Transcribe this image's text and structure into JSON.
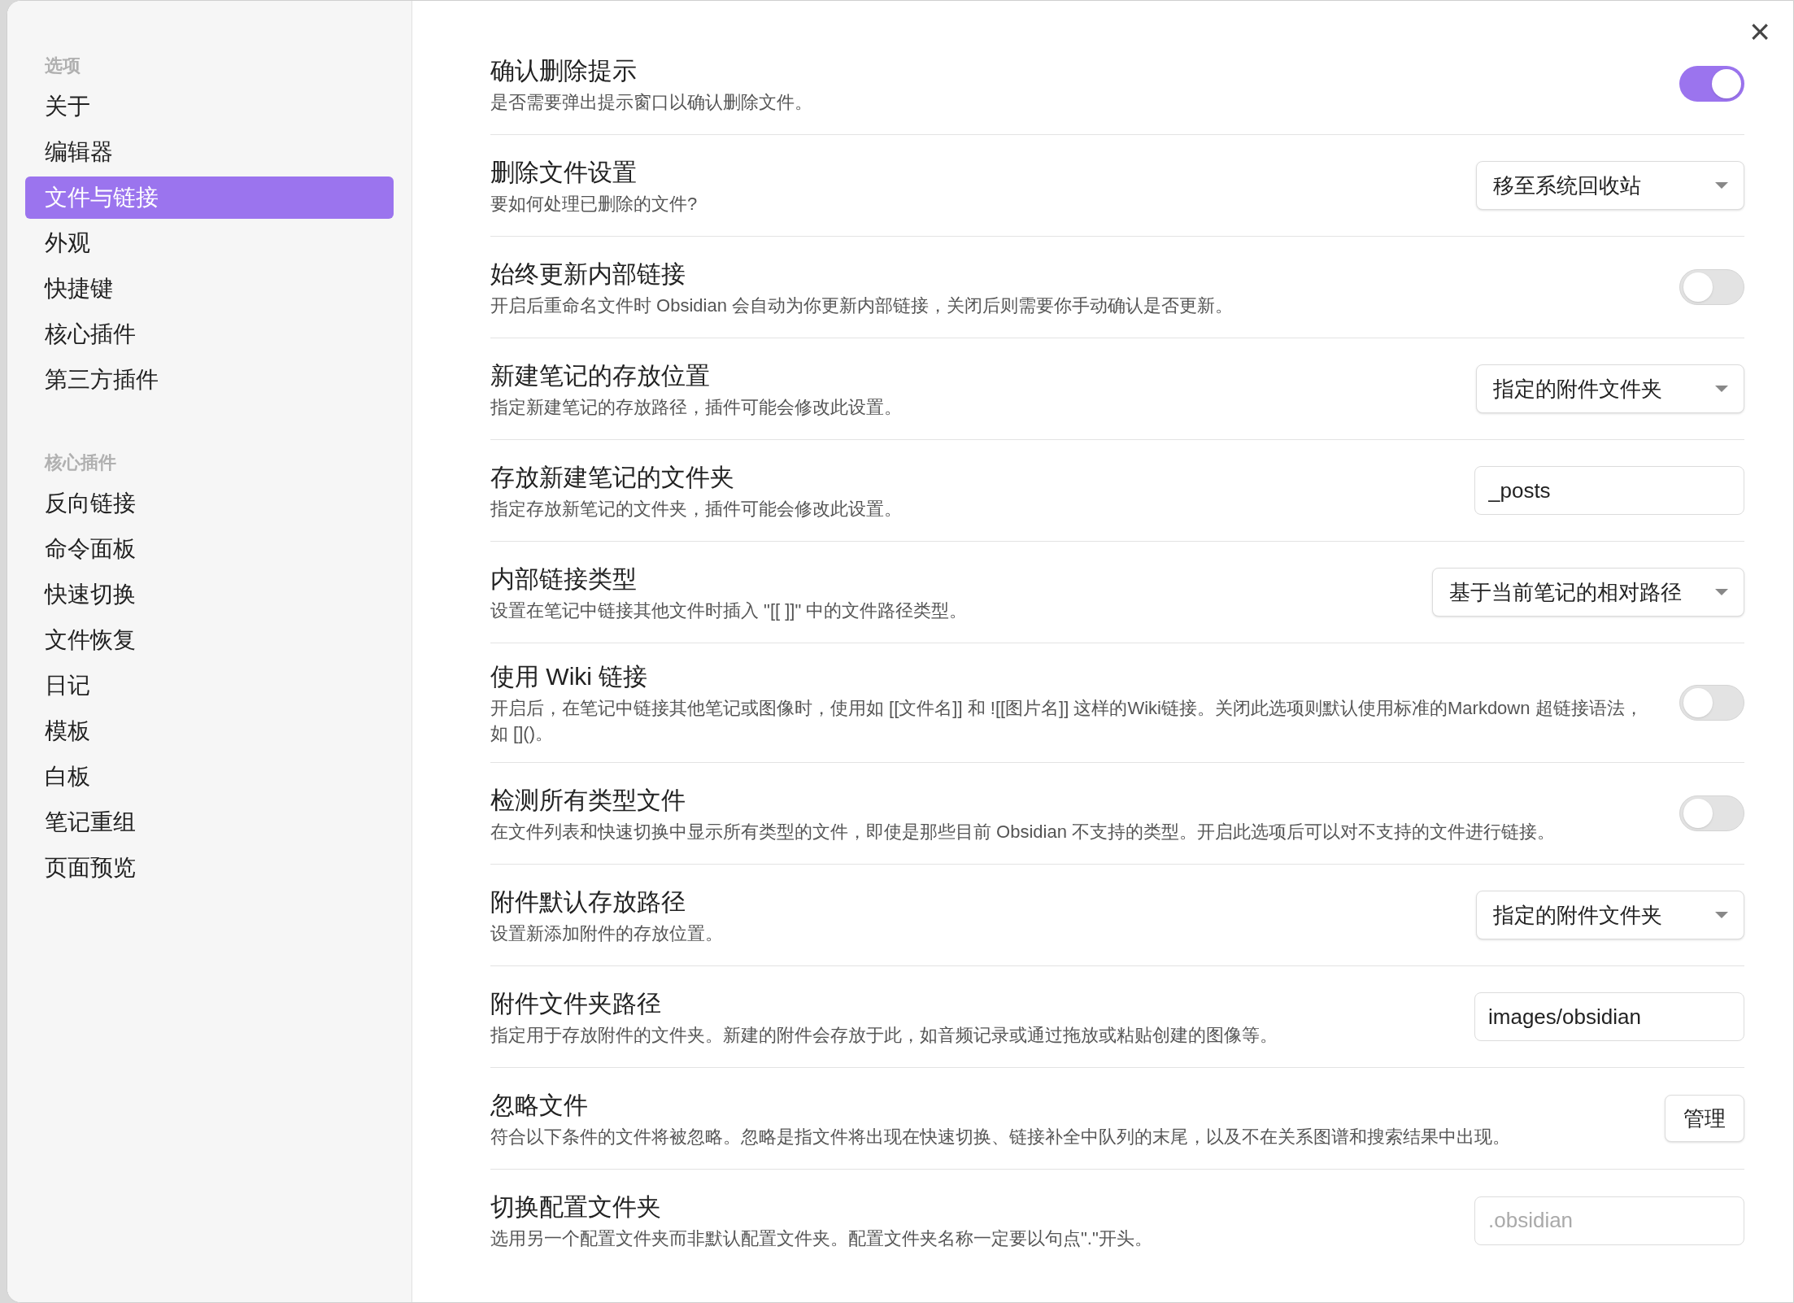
{
  "sidebar": [
    {
      "heading": "选项",
      "items": [
        {
          "label": "关于",
          "selected": false
        },
        {
          "label": "编辑器",
          "selected": false
        },
        {
          "label": "文件与链接",
          "selected": true
        },
        {
          "label": "外观",
          "selected": false
        },
        {
          "label": "快捷键",
          "selected": false
        },
        {
          "label": "核心插件",
          "selected": false
        },
        {
          "label": "第三方插件",
          "selected": false
        }
      ]
    },
    {
      "heading": "核心插件",
      "items": [
        {
          "label": "反向链接",
          "selected": false
        },
        {
          "label": "命令面板",
          "selected": false
        },
        {
          "label": "快速切换",
          "selected": false
        },
        {
          "label": "文件恢复",
          "selected": false
        },
        {
          "label": "日记",
          "selected": false
        },
        {
          "label": "模板",
          "selected": false
        },
        {
          "label": "白板",
          "selected": false
        },
        {
          "label": "笔记重组",
          "selected": false
        },
        {
          "label": "页面预览",
          "selected": false
        }
      ]
    }
  ],
  "close_button": "×",
  "settings": [
    {
      "title": "确认删除提示",
      "description": "是否需要弹出提示窗口以确认删除文件。",
      "control": {
        "kind": "toggle",
        "on": true
      }
    },
    {
      "title": "删除文件设置",
      "description": "要如何处理已删除的文件?",
      "control": {
        "kind": "dropdown",
        "value": "移至系统回收站"
      }
    },
    {
      "title": "始终更新内部链接",
      "description": "开启后重命名文件时 Obsidian 会自动为你更新内部链接，关闭后则需要你手动确认是否更新。",
      "control": {
        "kind": "toggle",
        "on": false
      }
    },
    {
      "title": "新建笔记的存放位置",
      "description": "指定新建笔记的存放路径，插件可能会修改此设置。",
      "control": {
        "kind": "dropdown",
        "value": "指定的附件文件夹"
      }
    },
    {
      "title": "存放新建笔记的文件夹",
      "description": "指定存放新笔记的文件夹，插件可能会修改此设置。",
      "control": {
        "kind": "text",
        "value": "_posts"
      }
    },
    {
      "title": "内部链接类型",
      "description": "设置在笔记中链接其他文件时插入 \"[[ ]]\" 中的文件路径类型。",
      "control": {
        "kind": "dropdown",
        "value": "基于当前笔记的相对路径"
      }
    },
    {
      "title": "使用 Wiki 链接",
      "description": "开启后，在笔记中链接其他笔记或图像时，使用如 [[文件名]] 和 ![[图片名]] 这样的Wiki链接。关闭此选项则默认使用标准的Markdown 超链接语法，如 []()。",
      "control": {
        "kind": "toggle",
        "on": false
      }
    },
    {
      "title": "检测所有类型文件",
      "description": "在文件列表和快速切换中显示所有类型的文件，即使是那些目前 Obsidian 不支持的类型。开启此选项后可以对不支持的文件进行链接。",
      "control": {
        "kind": "toggle",
        "on": false
      }
    },
    {
      "title": "附件默认存放路径",
      "description": "设置新添加附件的存放位置。",
      "control": {
        "kind": "dropdown",
        "value": "指定的附件文件夹"
      }
    },
    {
      "title": "附件文件夹路径",
      "description": "指定用于存放附件的文件夹。新建的附件会存放于此，如音频记录或通过拖放或粘贴创建的图像等。",
      "control": {
        "kind": "text",
        "value": "images/obsidian"
      }
    },
    {
      "title": "忽略文件",
      "description": "符合以下条件的文件将被忽略。忽略是指文件将出现在快速切换、链接补全中队列的末尾，以及不在关系图谱和搜索结果中出现。",
      "control": {
        "kind": "button",
        "label": "管理"
      }
    },
    {
      "title": "切换配置文件夹",
      "description": "选用另一个配置文件夹而非默认配置文件夹。配置文件夹名称一定要以句点\".\"开头。",
      "control": {
        "kind": "text",
        "placeholder": ".obsidian"
      }
    }
  ]
}
